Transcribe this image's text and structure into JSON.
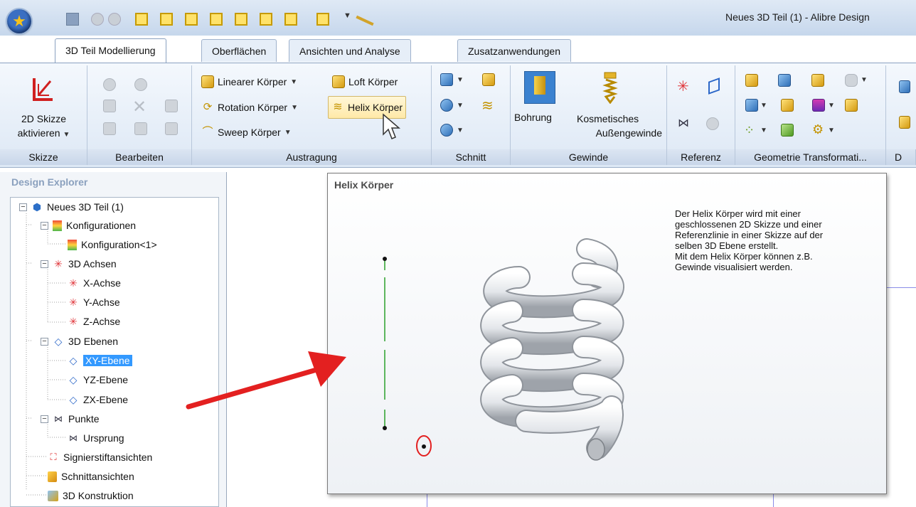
{
  "window": {
    "title": "Neues 3D Teil (1) - Alibre Design"
  },
  "tabs": [
    {
      "label": "3D Teil Modellierung",
      "active": true
    },
    {
      "label": "Oberflächen"
    },
    {
      "label": "Ansichten und Analyse"
    },
    {
      "label": "Zusatzanwendungen"
    }
  ],
  "ribbon": {
    "skizze": {
      "button_line1": "2D Skizze",
      "button_line2": "aktivieren",
      "group_label": "Skizze"
    },
    "bearbeiten": {
      "group_label": "Bearbeiten"
    },
    "austragung": {
      "linear": "Linearer Körper",
      "loft": "Loft Körper",
      "rotation": "Rotation Körper",
      "helix": "Helix Körper",
      "sweep": "Sweep Körper",
      "group_label": "Austragung"
    },
    "schnitt": {
      "group_label": "Schnitt"
    },
    "gewinde": {
      "bohrung": "Bohrung",
      "kosmetisch_line1": "Kosmetisches",
      "kosmetisch_line2": "Außengewinde",
      "group_label": "Gewinde"
    },
    "referenz": {
      "group_label": "Referenz"
    },
    "geometrie": {
      "group_label": "Geometrie Transformati..."
    },
    "cut_label": "D"
  },
  "explorer": {
    "title": "Design Explorer",
    "nodes": [
      "Neues 3D Teil (1)",
      "Konfigurationen",
      "Konfiguration<1>",
      "3D Achsen",
      "X-Achse",
      "Y-Achse",
      "Z-Achse",
      "3D Ebenen",
      "XY-Ebene",
      "YZ-Ebene",
      "ZX-Ebene",
      "Punkte",
      "Ursprung",
      "Signierstiftansichten",
      "Schnittansichten",
      "3D Konstruktion"
    ],
    "selected": "XY-Ebene"
  },
  "tooltip": {
    "title": "Helix Körper",
    "description": "Der Helix Körper wird mit einer\ngeschlossenen 2D Skizze und einer\nReferenzlinie in einer Skizze auf der\nselben 3D Ebene erstellt.\nMit dem Helix Körper können z.B.\nGewinde visualisiert werden."
  },
  "colors": {
    "ribbon_bg": "#dde8f5",
    "selection": "#3399ff",
    "arrow": "#e32020",
    "sketch_line": "#2aa02a"
  }
}
